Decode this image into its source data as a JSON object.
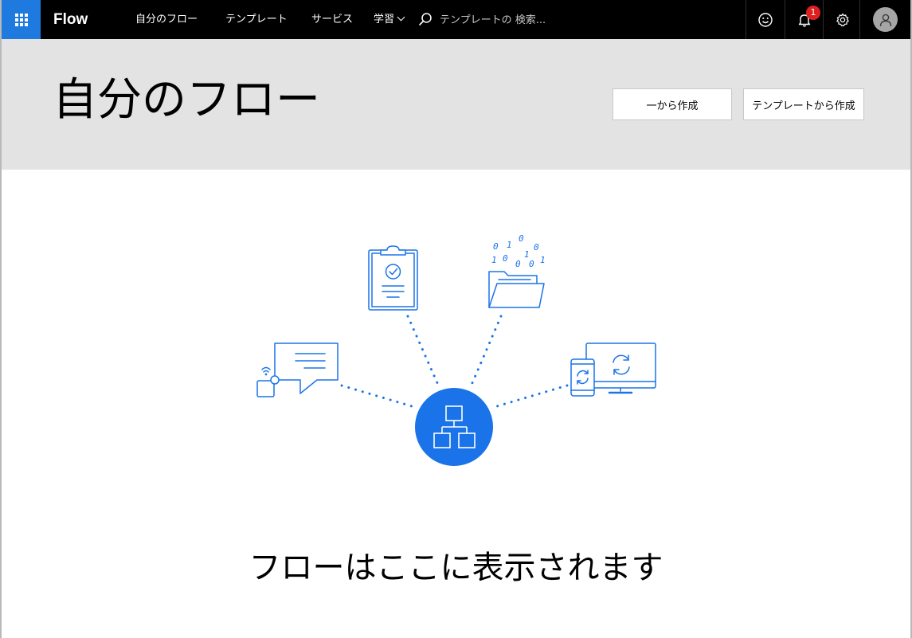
{
  "topbar": {
    "brand": "Flow",
    "nav": [
      {
        "label": "自分のフロー"
      },
      {
        "label": "テンプレート"
      },
      {
        "label": "サービス"
      },
      {
        "label": "学習"
      }
    ],
    "search_placeholder": "テンプレートの 検索...",
    "notification_count": "1",
    "icons": {
      "launcher": "waffle-icon",
      "search": "search-icon",
      "feedback": "smiley-icon",
      "notifications": "bell-icon",
      "settings": "gear-icon",
      "profile": "avatar-icon"
    }
  },
  "header": {
    "title": "自分のフロー",
    "create_blank_label": "一から作成",
    "create_template_label": "テンプレートから作成"
  },
  "illustration": {
    "binary_digits": [
      "0",
      "1",
      "0",
      "0",
      "1",
      "0",
      "1",
      "0",
      "0",
      "1"
    ],
    "icons": [
      "chat-bubble-icon",
      "clipboard-icon",
      "folder-icon",
      "devices-sync-icon",
      "flow-hub-icon"
    ]
  },
  "empty_state": {
    "message": "フローはここに表示されます"
  },
  "colors": {
    "accent": "#1f7ae0",
    "topbar_bg": "#000000",
    "header_bg": "#e3e3e3",
    "badge": "#e02020",
    "illustration_stroke": "#1a73e8"
  }
}
